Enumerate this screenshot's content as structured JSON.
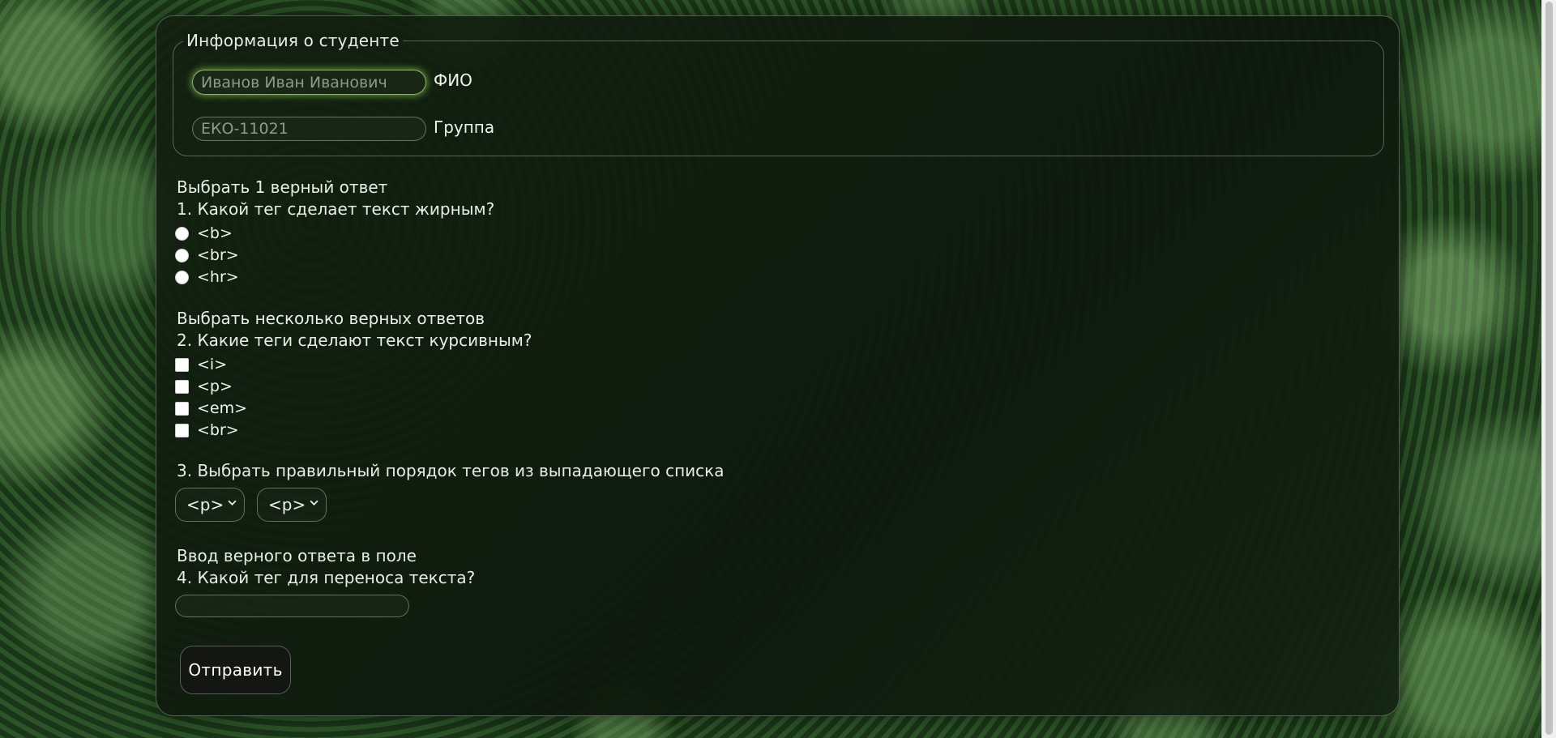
{
  "student_info": {
    "legend": "Информация о студенте",
    "fio": {
      "placeholder": "Иванов Иван Иванович",
      "value": "",
      "label": "ФИО"
    },
    "group": {
      "placeholder": "ЕКО-11021",
      "value": "",
      "label": "Группа"
    }
  },
  "q1": {
    "instruction": "Выбрать 1 верный ответ",
    "question": "1. Какой тег сделает текст жирным?",
    "options": [
      "<b>",
      "<br>",
      "<hr>"
    ]
  },
  "q2": {
    "instruction": "Выбрать несколько верных ответов",
    "question": "2. Какие теги сделают текст курсивным?",
    "options": [
      "<i>",
      "<p>",
      "<em>",
      "<br>"
    ]
  },
  "q3": {
    "question": "3. Выбрать правильный порядок тегов из выпадающего списка",
    "selects": [
      "<p>",
      "<p>"
    ]
  },
  "q4": {
    "instruction": "Ввод верного ответа в поле",
    "question": "4. Какой тег для переноса текста?",
    "answer_value": ""
  },
  "submit_label": "Отправить",
  "icons": {
    "select_arrow": "chevron-down-icon"
  }
}
